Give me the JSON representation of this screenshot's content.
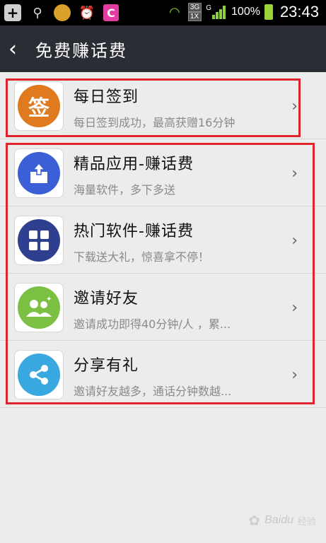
{
  "statusbar": {
    "network_g": "G",
    "network_3g": "3G",
    "network_1x": "1X",
    "battery_pct": "100%",
    "time": "23:43"
  },
  "titlebar": {
    "back_glyph": "‹",
    "title": "免费赚话费"
  },
  "items": [
    {
      "name": "每日签到",
      "desc": "每日签到成功，最高获赠16分钟",
      "icon": "sign-in-icon",
      "icon_text": "签",
      "color": "#e07a1f"
    },
    {
      "name": "精品应用-赚话费",
      "desc": "海量软件，多下多送",
      "icon": "download-box-icon",
      "color": "#3b5fd6"
    },
    {
      "name": "热门软件-赚话费",
      "desc": "下载送大礼，惊喜拿不停！",
      "icon": "app-grid-icon",
      "color": "#2f3f8f"
    },
    {
      "name": "邀请好友",
      "desc": "邀请成功即得40分钟/人 ，累...",
      "icon": "friends-icon",
      "color": "#7bc043"
    },
    {
      "name": "分享有礼",
      "desc": "邀请好友越多，通话分钟数越...",
      "icon": "share-icon",
      "color": "#3aa8e0"
    }
  ],
  "chevron": "›",
  "watermark": {
    "brand": "Baidu",
    "sub": "经验"
  },
  "colors": {
    "highlight": "#e0242d",
    "titlebar": "#2a2d33",
    "background": "#ececec"
  }
}
